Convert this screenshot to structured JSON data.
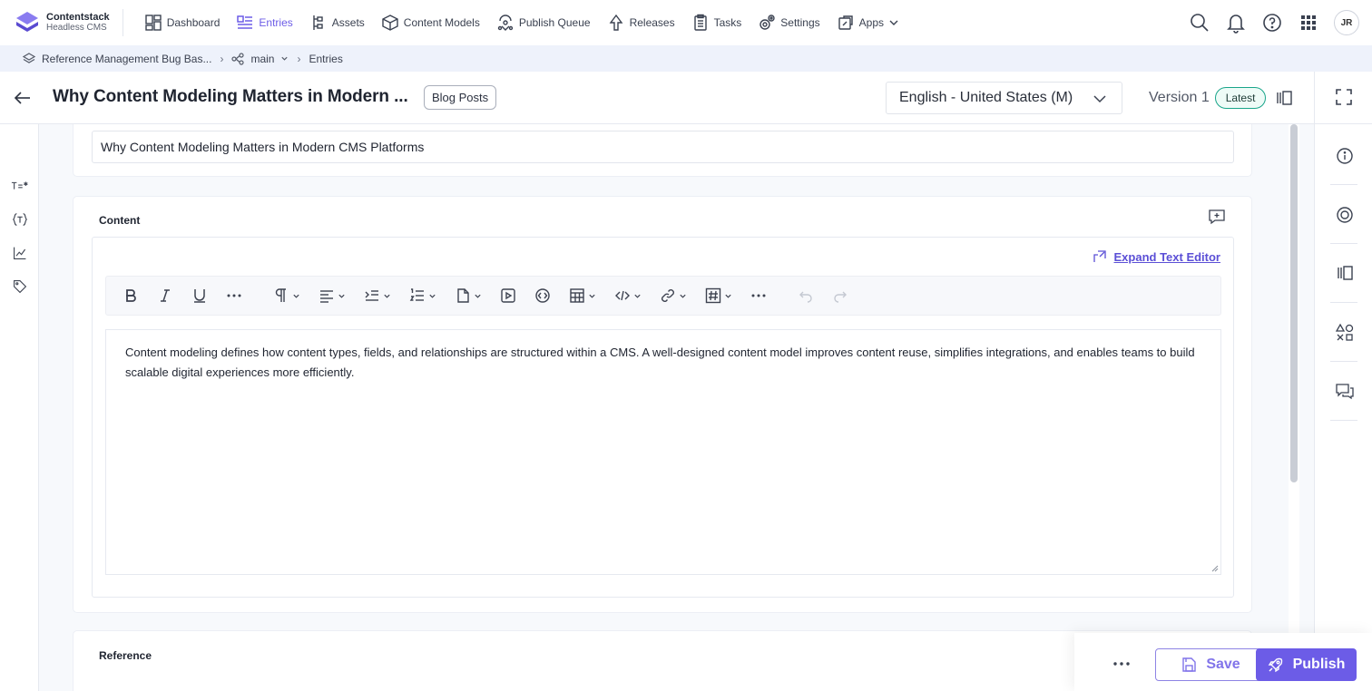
{
  "brand": {
    "name": "Contentstack",
    "subtitle": "Headless CMS"
  },
  "nav": {
    "items": [
      {
        "label": "Dashboard",
        "icon": "dashboard-icon"
      },
      {
        "label": "Entries",
        "icon": "entries-icon",
        "active": true
      },
      {
        "label": "Assets",
        "icon": "assets-icon"
      },
      {
        "label": "Content Models",
        "icon": "content-models-icon"
      },
      {
        "label": "Publish Queue",
        "icon": "publish-queue-icon"
      },
      {
        "label": "Releases",
        "icon": "releases-icon"
      },
      {
        "label": "Tasks",
        "icon": "tasks-icon"
      },
      {
        "label": "Settings",
        "icon": "settings-icon"
      },
      {
        "label": "Apps",
        "icon": "apps-icon"
      }
    ],
    "user_initials": "JR"
  },
  "breadcrumb": {
    "stack": "Reference Management Bug Bas...",
    "branch": "main",
    "section": "Entries"
  },
  "entry": {
    "title": "Why Content Modeling Matters in Modern ...",
    "content_type": "Blog Posts",
    "locale": "English - United States (M)",
    "version": "Version 1",
    "version_badge": "Latest"
  },
  "fields": {
    "title_value": "Why Content Modeling Matters in Modern CMS Platforms",
    "content_label": "Content",
    "expand_editor_label": "Expand Text Editor",
    "content_body": "Content modeling defines how content types, fields, and relationships are structured within a CMS. A well-designed content model improves content reuse, simplifies integrations, and enables teams to build scalable digital experiences more efficiently.",
    "reference_label": "Reference"
  },
  "actions": {
    "save_label": "Save",
    "publish_label": "Publish"
  },
  "colors": {
    "accent": "#6c5ce7",
    "breadcrumb_bg": "#eef2fb",
    "latest_border": "#19a58a"
  }
}
